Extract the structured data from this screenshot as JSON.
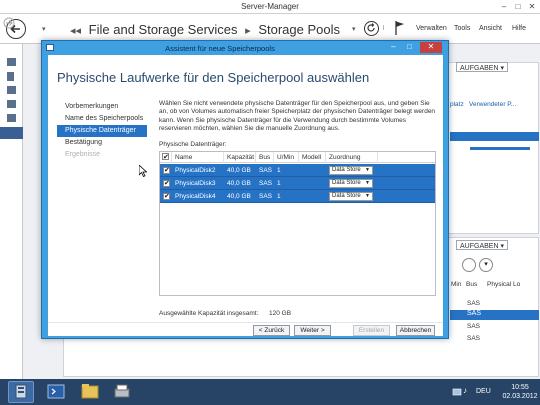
{
  "server_manager": {
    "title": "Server-Manager",
    "window_controls": [
      "–",
      "□",
      "✕"
    ],
    "breadcrumb": [
      "File and Storage Services",
      "Storage Pools"
    ],
    "breadcrumb_prefix": "◂◂",
    "menu": [
      "Verwalten",
      "Tools",
      "Ansicht",
      "Hilfe"
    ],
    "aufgaben_label": "AUFGABEN",
    "aufgaben_arrow": "▾",
    "bg_columns": [
      "platz",
      "Verwendeter P..."
    ],
    "bg_columns_lower": [
      "Min",
      "Bus",
      "Physical Lo"
    ],
    "bg_sas": [
      "SAS",
      "SAS",
      "SAS",
      "SAS"
    ]
  },
  "wizard": {
    "title": "Assistent für neue Speicherpools",
    "window_controls": [
      "–",
      "□",
      "✕"
    ],
    "heading": "Physische Laufwerke für den Speicherpool auswählen",
    "nav": [
      {
        "label": "Vorbemerkungen",
        "state": "normal"
      },
      {
        "label": "Name des Speicherpools",
        "state": "normal"
      },
      {
        "label": "Physische Datenträger",
        "state": "current"
      },
      {
        "label": "Bestätigung",
        "state": "normal"
      },
      {
        "label": "Ergebnisse",
        "state": "disabled"
      }
    ],
    "description": "Wählen Sie nicht verwendete physische Datenträger für den Speicherpool aus, und geben Sie an, ob von Volumes automatisch freier Speicherplatz der physischen Datenträger belegt werden kann. Wenn Sie physische Datenträger für die Verwendung durch bestimmte Volumes reservieren möchten, wählen Sie die manuelle Zuordnung aus.",
    "table_label": "Physische Datenträger:",
    "columns": [
      "Name",
      "Kapazität",
      "Bus",
      "U/Min",
      "Modell",
      "Zuordnung"
    ],
    "disks": [
      {
        "name": "PhysicalDisk2",
        "capacity": "40,0 GB",
        "bus": "SAS",
        "rpm": "1",
        "model": "",
        "assignment": "Data Store",
        "checked": true
      },
      {
        "name": "PhysicalDisk3",
        "capacity": "40,0 GB",
        "bus": "SAS",
        "rpm": "1",
        "model": "",
        "assignment": "Data Store",
        "checked": true
      },
      {
        "name": "PhysicalDisk4",
        "capacity": "40,0 GB",
        "bus": "SAS",
        "rpm": "1",
        "model": "",
        "assignment": "Data Store",
        "checked": true
      }
    ],
    "capacity_label": "Ausgewählte Kapazität insgesamt:",
    "capacity_value": "120 GB",
    "buttons": {
      "back": "< Zurück",
      "next": "Weiter >",
      "create": "Erstellen",
      "cancel": "Abbrechen"
    }
  },
  "taskbar": {
    "language": "DEU",
    "time": "10:55",
    "date": "02.03.2012"
  }
}
